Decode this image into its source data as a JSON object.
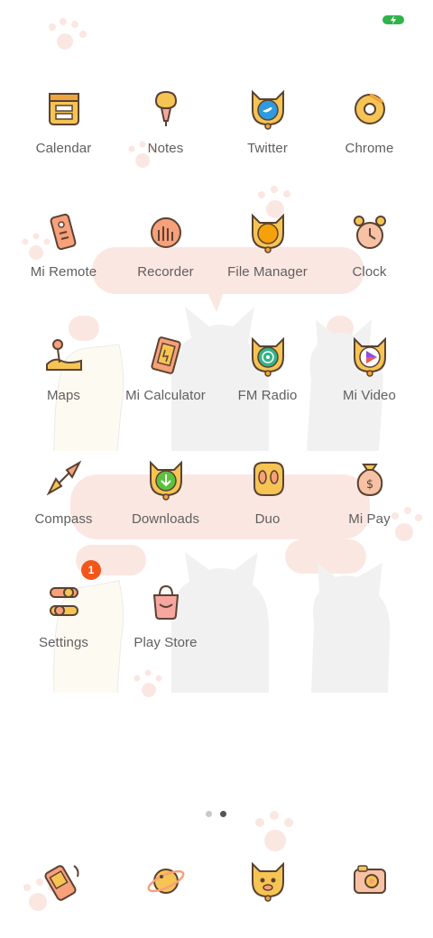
{
  "status_bar": {
    "battery_icon": "battery-charging-icon"
  },
  "apps": [
    {
      "name": "Calendar",
      "icon": "calendar-icon"
    },
    {
      "name": "Notes",
      "icon": "notes-icon"
    },
    {
      "name": "Twitter",
      "icon": "twitter-icon"
    },
    {
      "name": "Chrome",
      "icon": "chrome-icon"
    },
    {
      "name": "Mi Remote",
      "icon": "remote-icon"
    },
    {
      "name": "Recorder",
      "icon": "recorder-icon"
    },
    {
      "name": "File Manager",
      "icon": "file-manager-icon"
    },
    {
      "name": "Clock",
      "icon": "clock-icon"
    },
    {
      "name": "Maps",
      "icon": "maps-icon"
    },
    {
      "name": "Mi Calculator",
      "icon": "calculator-icon"
    },
    {
      "name": "FM Radio",
      "icon": "radio-icon"
    },
    {
      "name": "Mi Video",
      "icon": "video-icon"
    },
    {
      "name": "Compass",
      "icon": "compass-icon"
    },
    {
      "name": "Downloads",
      "icon": "downloads-icon"
    },
    {
      "name": "Duo",
      "icon": "duo-icon"
    },
    {
      "name": "Mi Pay",
      "icon": "mi-pay-icon"
    },
    {
      "name": "Settings",
      "icon": "settings-icon",
      "badge": "1"
    },
    {
      "name": "Play Store",
      "icon": "play-store-icon"
    }
  ],
  "page_indicator": {
    "pages": 2,
    "current": 2
  },
  "dock": [
    {
      "icon": "phone-icon"
    },
    {
      "icon": "browser-icon"
    },
    {
      "icon": "messages-icon"
    },
    {
      "icon": "camera-icon"
    }
  ],
  "colors": {
    "accent": "#f5b43c",
    "outline": "#5a4232",
    "badge": "#f2561a",
    "label": "#5f5f5f"
  }
}
